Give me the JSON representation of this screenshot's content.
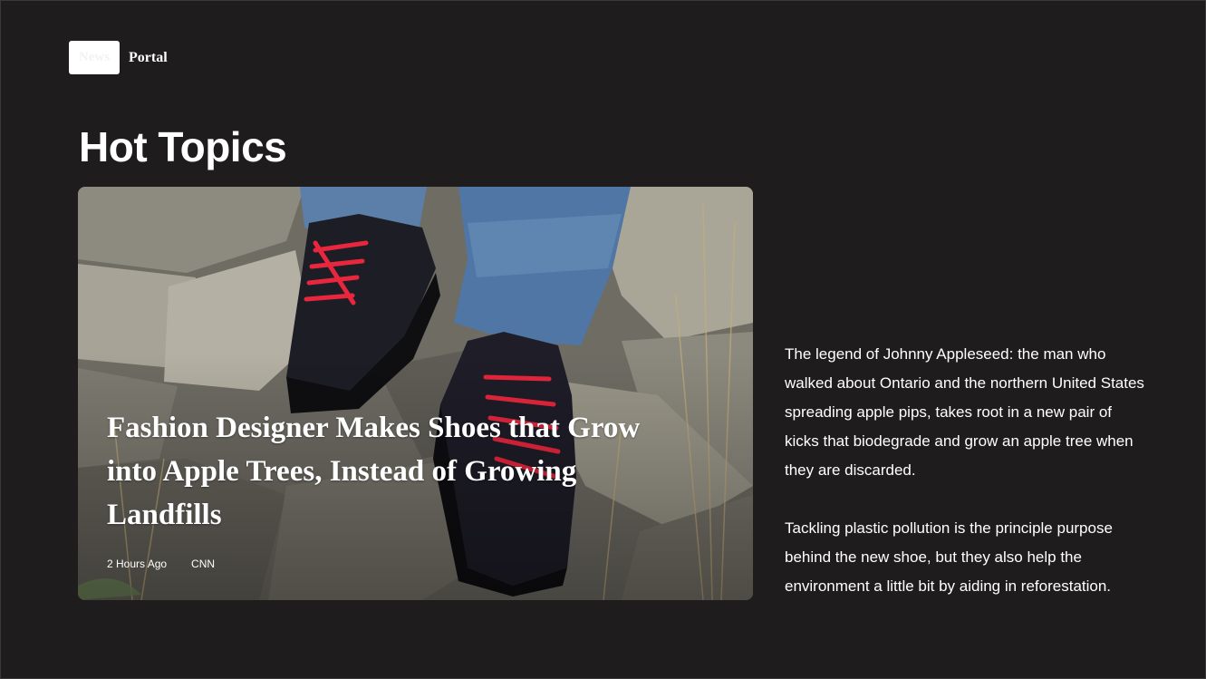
{
  "brand": {
    "logo_box_text": "News",
    "logo_text": "Portal"
  },
  "section": {
    "title": "Hot Topics"
  },
  "feature": {
    "title": "Fashion Designer Makes Shoes that Grow into Apple Trees, Instead of Growing Landfills",
    "time": "2 Hours Ago",
    "source": "CNN",
    "image_description": "photo-shoes-on-rocks"
  },
  "description": {
    "paragraphs": [
      "The legend of Johnny Appleseed: the man who walked about Ontario and the northern United States spreading apple pips, takes root in a new pair of kicks that biodegrade and grow an apple tree when they are discarded.",
      "Tackling plastic pollution is the principle purpose behind the new shoe, but they also help the environment a little bit by aiding in reforestation."
    ]
  },
  "colors": {
    "background": "#1e1c1d",
    "text": "#ffffff",
    "lace": "#e8263d"
  }
}
